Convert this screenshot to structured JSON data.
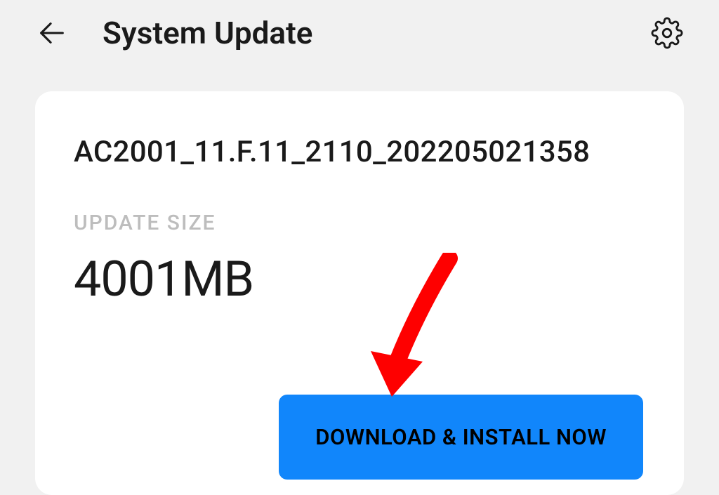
{
  "header": {
    "title": "System Update"
  },
  "update": {
    "version": "AC2001_11.F.11_2110_202205021358",
    "size_label": "UPDATE SIZE",
    "size_value": "4001MB",
    "download_label": "DOWNLOAD & INSTALL NOW"
  }
}
